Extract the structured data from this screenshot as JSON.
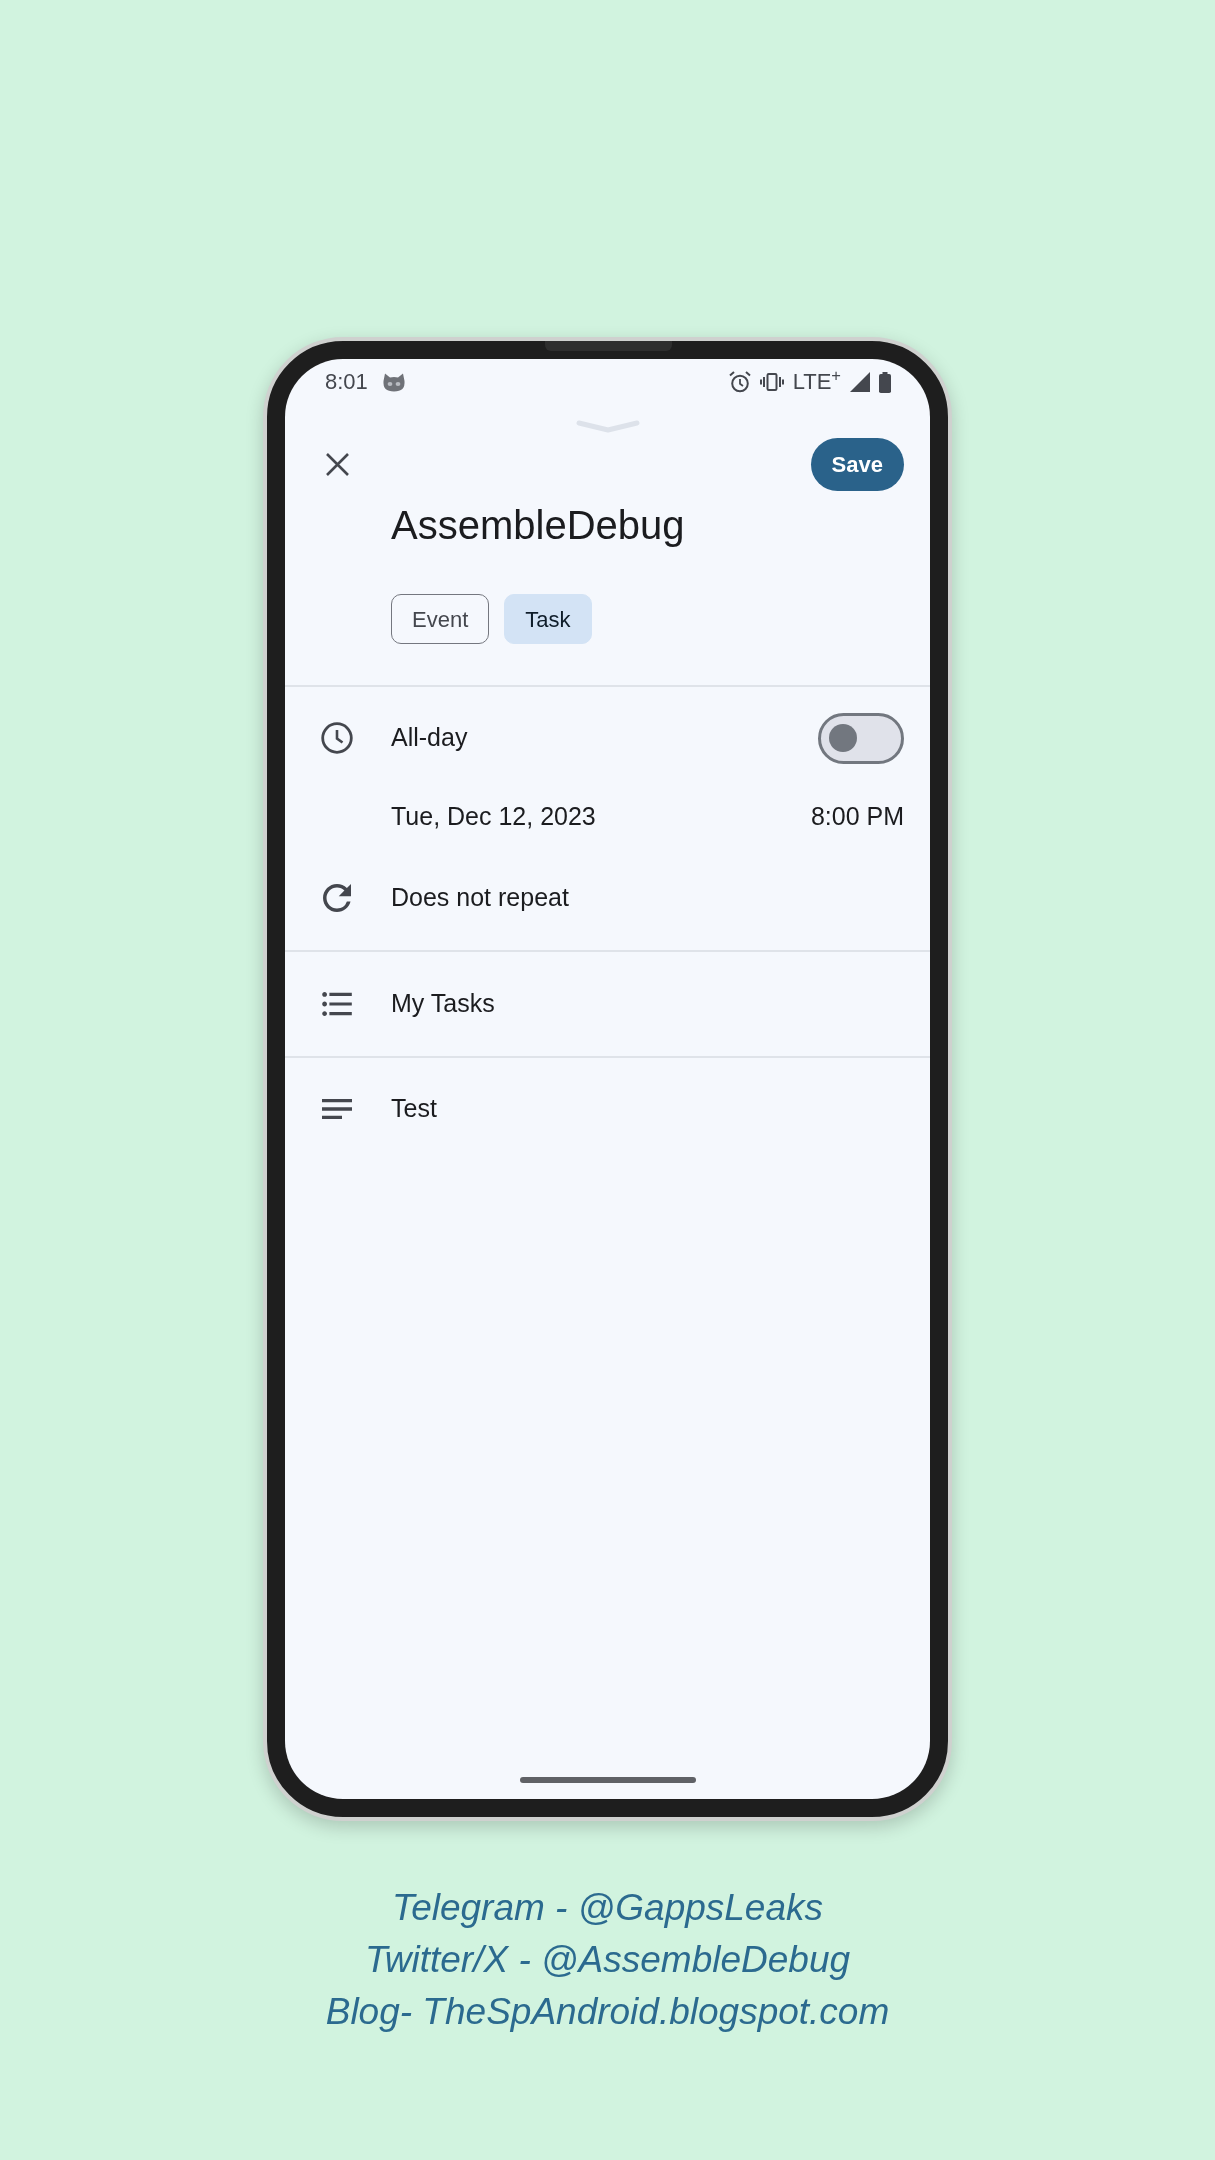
{
  "status_bar": {
    "time": "8:01",
    "network": "LTE$^{+}$"
  },
  "save_button": {
    "label": "Save"
  },
  "title": "AssembleDebug",
  "type_chips": [
    {
      "label": "Event",
      "selected": false
    },
    {
      "label": "Task",
      "selected": true
    }
  ],
  "all_day": {
    "label": "All-day",
    "on": false
  },
  "date_time": {
    "date": "Tue, Dec 12, 2023",
    "time": "8:00 PM"
  },
  "repeat": "Does not repeat",
  "task_list": "My Tasks",
  "description": "Test",
  "credits": [
    "Telegram - @GappsLeaks",
    "Twitter/X - @AssembleDebug",
    "Blog- TheSpAndroid.blogspot.com"
  ]
}
